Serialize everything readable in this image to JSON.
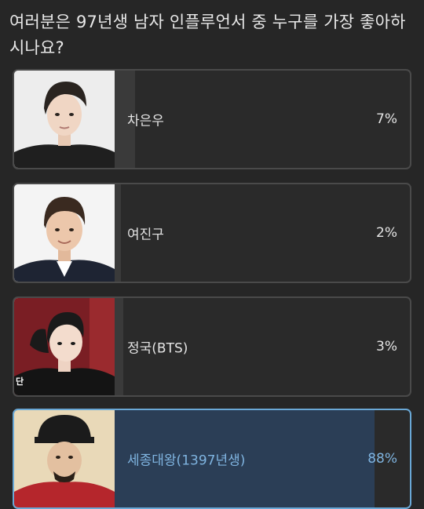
{
  "poll": {
    "question": "여러분은 97년생 남자 인플루언서 중 누구를 가장 좋아하시나요?",
    "options": [
      {
        "label": "차은우",
        "percent_text": "7%",
        "percent": 7,
        "selected": false
      },
      {
        "label": "여진구",
        "percent_text": "2%",
        "percent": 2,
        "selected": false
      },
      {
        "label": "정국(BTS)",
        "percent_text": "3%",
        "percent": 3,
        "selected": false,
        "photo_corner_text": "단"
      },
      {
        "label": "세종대왕(1397년생)",
        "percent_text": "88%",
        "percent": 88,
        "selected": true
      }
    ]
  },
  "colors": {
    "background": "#262626",
    "option_border": "#4a4a4a",
    "option_fill": "#3a3a3a",
    "selected_border": "#6aa8d6",
    "selected_fill": "#2b3e56",
    "selected_text": "#7fb4e0"
  }
}
